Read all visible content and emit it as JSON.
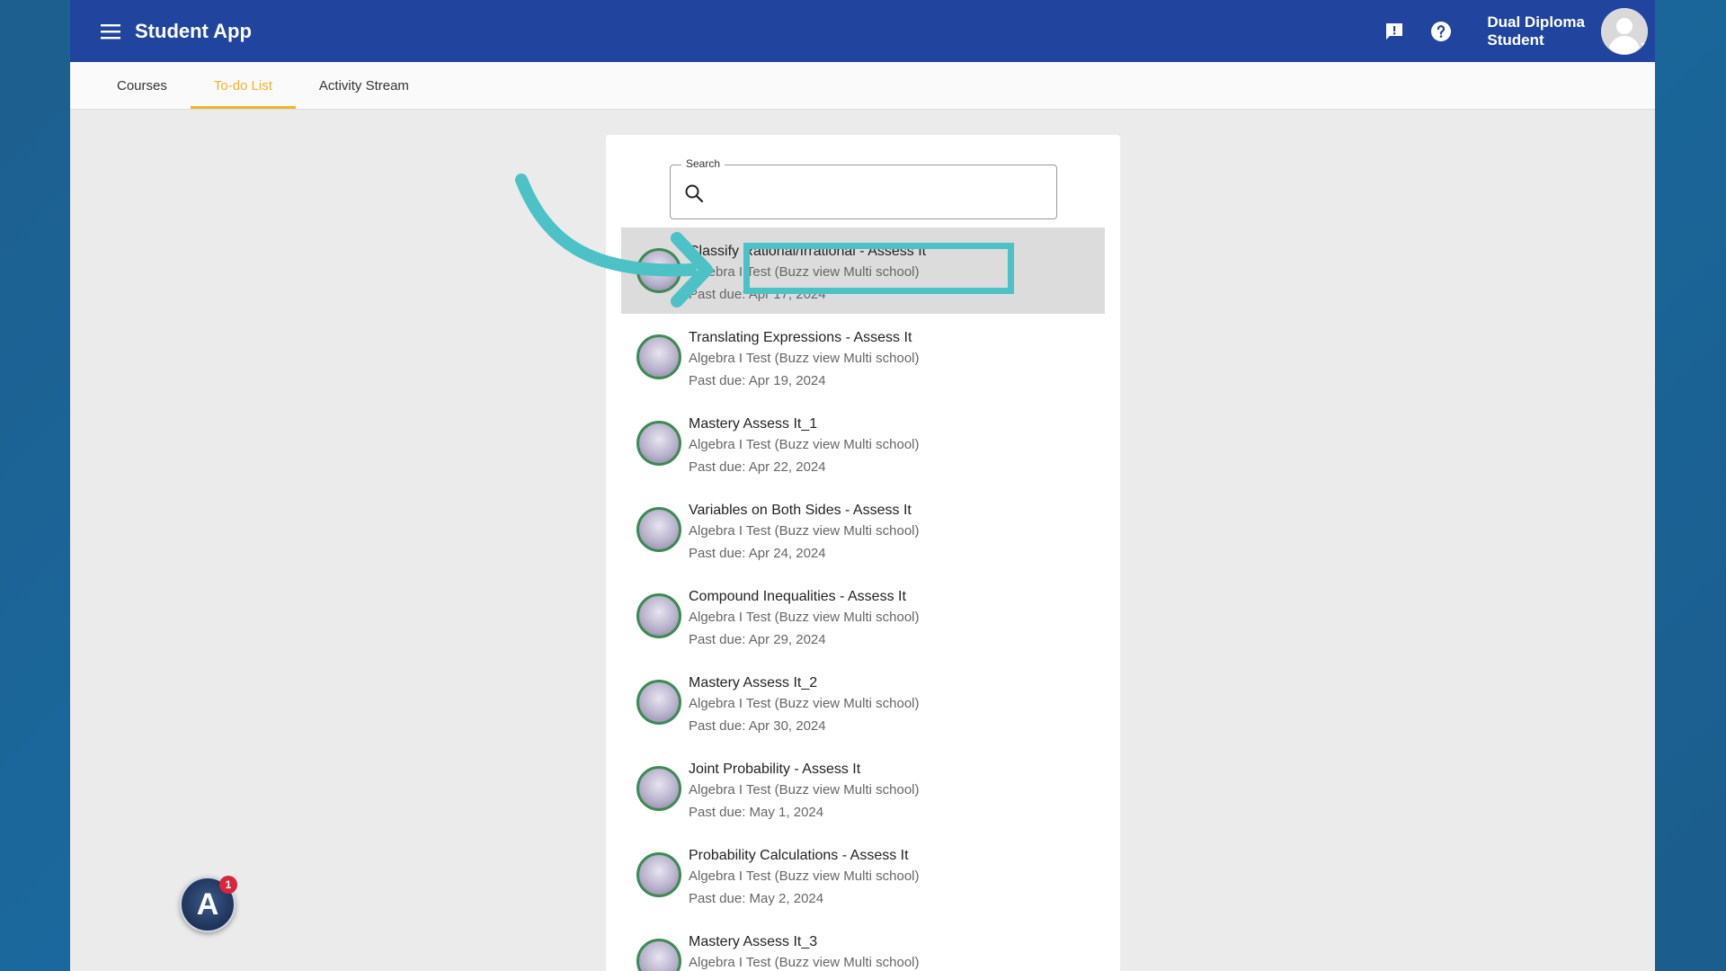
{
  "header": {
    "title": "Student App",
    "user_name_line1": "Dual Diploma",
    "user_name_line2": "Student"
  },
  "tabs": [
    {
      "label": "Courses"
    },
    {
      "label": "To-do List"
    },
    {
      "label": "Activity Stream"
    }
  ],
  "search": {
    "label": "Search",
    "value": ""
  },
  "todo": [
    {
      "title": "Classify Rational/Irrational - Assess It",
      "course": "Algebra I Test (Buzz view Multi school)",
      "due": "Past due: Apr 17, 2024"
    },
    {
      "title": "Translating Expressions - Assess It",
      "course": "Algebra I Test (Buzz view Multi school)",
      "due": "Past due: Apr 19, 2024"
    },
    {
      "title": "Mastery Assess It_1",
      "course": "Algebra I Test (Buzz view Multi school)",
      "due": "Past due: Apr 22, 2024"
    },
    {
      "title": "Variables on Both Sides - Assess It",
      "course": "Algebra I Test (Buzz view Multi school)",
      "due": "Past due: Apr 24, 2024"
    },
    {
      "title": "Compound Inequalities - Assess It",
      "course": "Algebra I Test (Buzz view Multi school)",
      "due": "Past due: Apr 29, 2024"
    },
    {
      "title": "Mastery Assess It_2",
      "course": "Algebra I Test (Buzz view Multi school)",
      "due": "Past due: Apr 30, 2024"
    },
    {
      "title": "Joint Probability - Assess It",
      "course": "Algebra I Test (Buzz view Multi school)",
      "due": "Past due: May 1, 2024"
    },
    {
      "title": "Probability Calculations - Assess It",
      "course": "Algebra I Test (Buzz view Multi school)",
      "due": "Past due: May 2, 2024"
    },
    {
      "title": "Mastery Assess It_3",
      "course": "Algebra I Test (Buzz view Multi school)",
      "due": ""
    }
  ],
  "notification": {
    "logo_letter": "A",
    "count": "1"
  },
  "colors": {
    "header": "#21459f",
    "tab_active": "#f0b429",
    "annotation": "#4cc1c6"
  }
}
